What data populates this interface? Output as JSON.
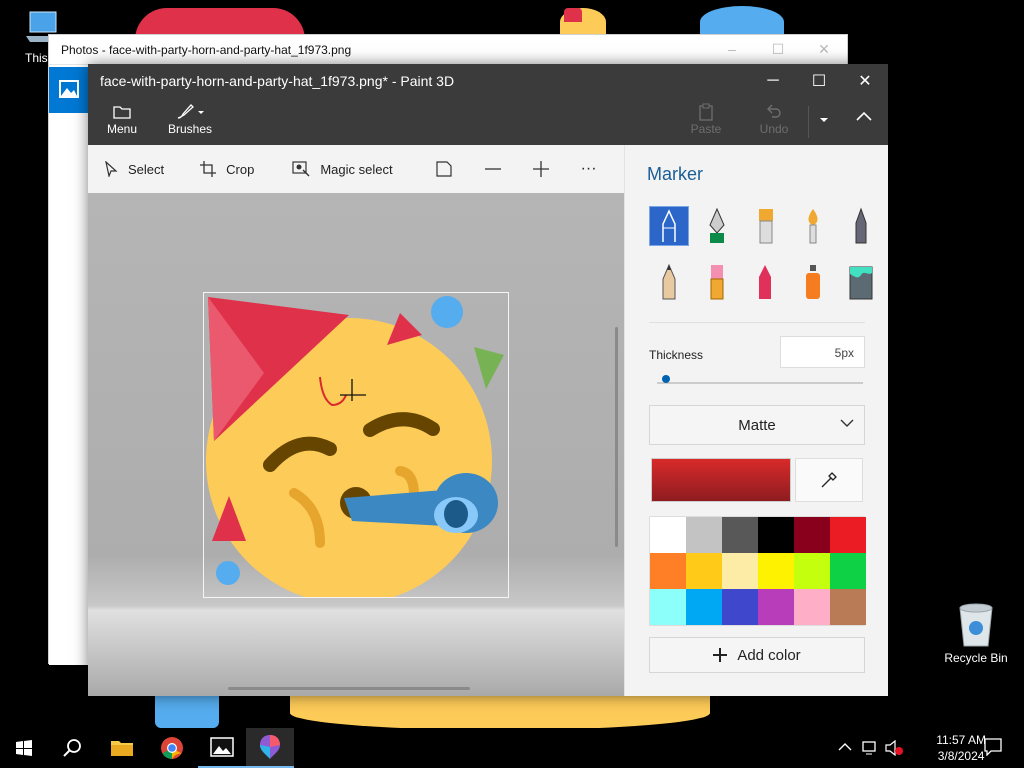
{
  "desktop": {
    "icons": [
      {
        "name": "this-pc",
        "label": "This P"
      },
      {
        "name": "recycle-bin",
        "label": "Recycle Bin"
      }
    ]
  },
  "photos_window": {
    "title": "Photos - face-with-party-horn-and-party-hat_1f973.png",
    "controls": [
      "–",
      "☐",
      "✕"
    ]
  },
  "paint_window": {
    "title": "face-with-party-horn-and-party-hat_1f973.png* - Paint 3D",
    "window_controls": {
      "minimize": "─",
      "maximize": "☐",
      "close": "✕"
    },
    "ribbon": {
      "menu_label": "Menu",
      "brushes_label": "Brushes",
      "paste_label": "Paste",
      "undo_label": "Undo"
    },
    "toolbar": {
      "select_label": "Select",
      "crop_label": "Crop",
      "magic_select_label": "Magic select",
      "more_label": "···"
    },
    "panel": {
      "title": "Marker",
      "brushes": [
        "marker",
        "calligraphy-pen",
        "oil-brush",
        "watercolor",
        "pixel-pen",
        "pencil",
        "eraser",
        "crayon",
        "spray-can",
        "fill"
      ],
      "selected_brush": "marker",
      "thickness_label": "Thickness",
      "thickness_value": "5px",
      "thickness_fraction": 0.05,
      "finish_value": "Matte",
      "current_color": "#d82a2a",
      "palette": [
        "#ffffff",
        "#c3c3c3",
        "#585858",
        "#000000",
        "#88001b",
        "#ec1c24",
        "#ff7f27",
        "#ffca18",
        "#fdeca6",
        "#fff200",
        "#c4ff0e",
        "#0ed145",
        "#8cfffb",
        "#00a8f3",
        "#3f48cc",
        "#b83dba",
        "#ffaec8",
        "#b97a56"
      ],
      "add_color_label": "Add color"
    }
  },
  "taskbar": {
    "apps": [
      "start",
      "search",
      "file-explorer",
      "chrome",
      "photos",
      "paint-3d"
    ],
    "time": "11:57 AM",
    "date": "3/8/2024"
  }
}
